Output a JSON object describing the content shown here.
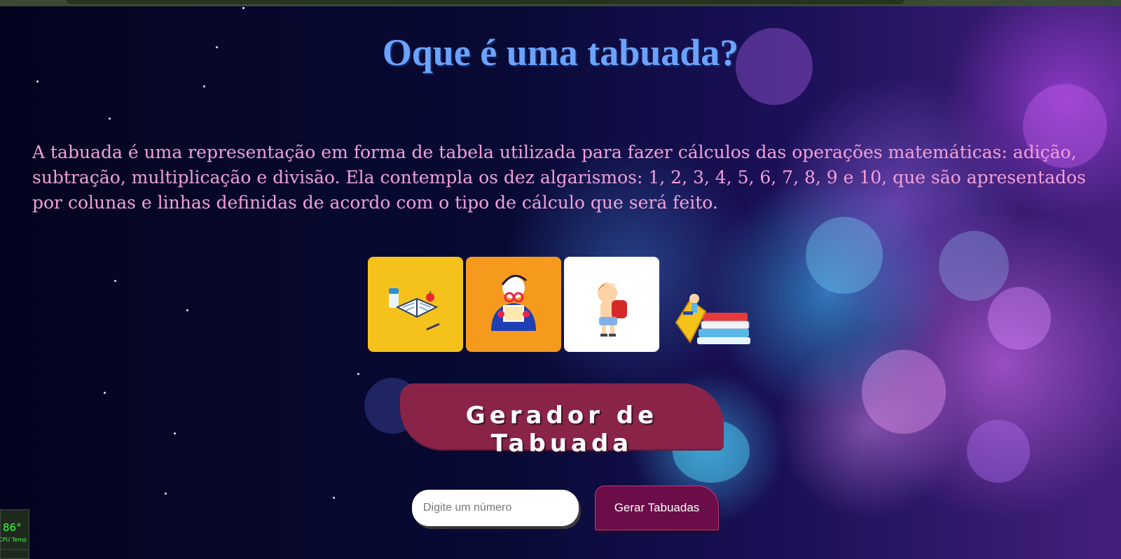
{
  "page": {
    "title": "Oque é uma tabuada?",
    "intro_text": "A tabuada é uma representação em forma de tabela utilizada para fazer cálculos das operações matemáticas: adição, subtração, multiplicação e divisão. Ela contempla os dez algarismos: 1, 2, 3, 4, 5, 6, 7, 8, 9 e 10, que são apresentados por colunas e linhas definidas de acordo com o tipo de cálculo que será feito."
  },
  "gallery": {
    "images": [
      {
        "name": "study-desk-illustration",
        "background": "#f5c21b"
      },
      {
        "name": "reading-girl-illustration",
        "background": "#f59a1c"
      },
      {
        "name": "schoolboy-backpack-illustration",
        "background": "#ffffff"
      },
      {
        "name": "boy-on-books-illustration",
        "background": "transparent"
      }
    ]
  },
  "generator": {
    "banner_title": "Gerador de Tabuada",
    "input_placeholder": "Digite um número",
    "input_value": "",
    "button_label": "Gerar Tabuadas"
  },
  "system_widget": {
    "value": "86°",
    "label": "CPU Temp"
  },
  "colors": {
    "title": "#6aa3ff",
    "intro_text": "#f2a0d8",
    "banner": "#8a2348",
    "button": "#6b0d48"
  }
}
